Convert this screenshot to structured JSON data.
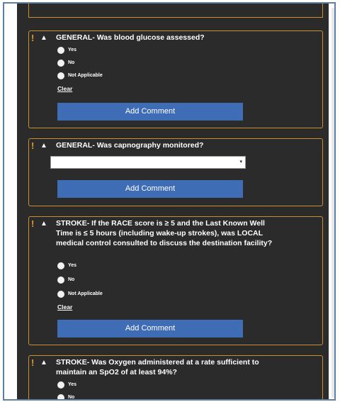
{
  "questions": [
    {
      "text": "GENERAL- Was blood glucose assessed?",
      "options": [
        "Yes",
        "No",
        "Not Applicable"
      ],
      "clear": "Clear",
      "add_comment": "Add Comment"
    },
    {
      "text": "GENERAL- Was capnography monitored?",
      "select_value": "",
      "add_comment": "Add Comment"
    },
    {
      "text": "STROKE- If the RACE score is ≥ 5 and the Last Known Well Time is ≤ 5 hours (including wake-up strokes), was LOCAL medical control consulted to discuss the destination facility?",
      "options": [
        "Yes",
        "No",
        "Not Applicable"
      ],
      "clear": "Clear",
      "add_comment": "Add Comment"
    },
    {
      "text": "STROKE- Was Oxygen administered at a rate sufficient to maintain an SpO2 of at least 94%?",
      "options": [
        "Yes",
        "No"
      ]
    }
  ],
  "icons": {
    "warning": "!",
    "collapse": "^",
    "dropdown": "▾"
  },
  "colors": {
    "panel_bg": "#2b2b2b",
    "card_border": "#c8902e",
    "warning": "#e39a2c",
    "button": "#3f6db5"
  }
}
